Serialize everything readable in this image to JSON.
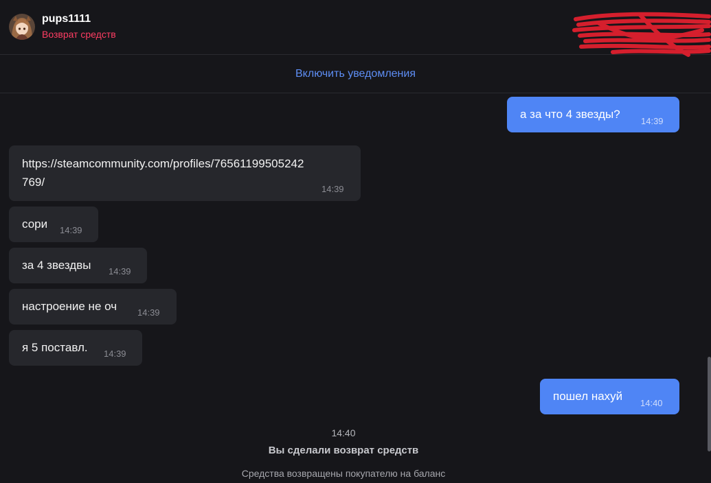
{
  "header": {
    "username": "pups1111",
    "status": "Возврат средств",
    "avatar_icon": "anime-girl-avatar",
    "redaction_color": "#e0202f"
  },
  "notifications": {
    "link_label": "Включить уведомления"
  },
  "messages": [
    {
      "direction": "out",
      "text": "а за что 4 звезды?",
      "time": "14:39"
    },
    {
      "direction": "in",
      "text_line1": "https://steamcommunity.com/profiles/76561199505242",
      "text_line2": "769/",
      "time": "14:39"
    },
    {
      "direction": "in",
      "text": "сори",
      "time": "14:39"
    },
    {
      "direction": "in",
      "text": "за 4 звездвы",
      "time": "14:39"
    },
    {
      "direction": "in",
      "text": "настроение не оч",
      "time": "14:39"
    },
    {
      "direction": "in",
      "text": "я 5 поставл.",
      "time": "14:39"
    },
    {
      "direction": "out",
      "text": "пошел нахуй",
      "time": "14:40"
    }
  ],
  "system_notice": {
    "time": "14:40",
    "title": "Вы сделали возврат средств",
    "description": "Средства возвращены покупателю на баланс"
  },
  "colors": {
    "background": "#16161a",
    "incoming_bubble": "#26272c",
    "outgoing_bubble": "#4f85f5",
    "link": "#5e8ef5",
    "status": "#ff3d63"
  }
}
